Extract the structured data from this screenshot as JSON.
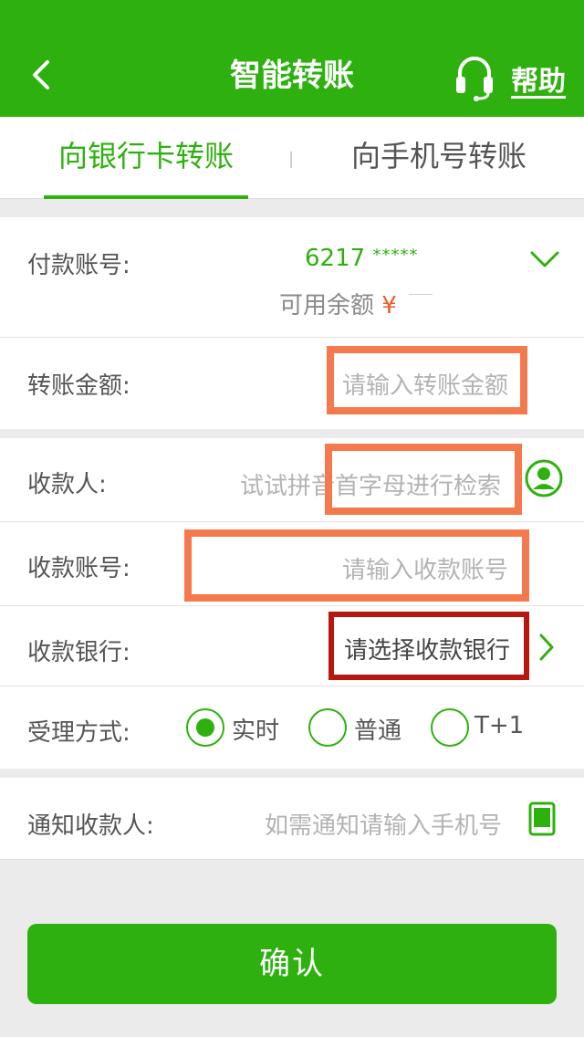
{
  "header": {
    "title": "智能转账",
    "back_icon": "chevron-left-icon",
    "help_icon": "headset-icon",
    "help_label": "帮助"
  },
  "tabs": [
    {
      "label": "向银行卡转账",
      "active": true
    },
    {
      "label": "向手机号转账",
      "active": false
    }
  ],
  "payment": {
    "account_label": "付款账号:",
    "account_number": "6217",
    "account_mask": "*****",
    "balance_label": "可用余额",
    "balance_currency": "¥",
    "amount_label": "转账金额:",
    "amount_placeholder": "请输入转账金额"
  },
  "payee": {
    "name_label": "收款人:",
    "name_placeholder": "试试拼音首字母进行检索",
    "contact_icon": "contact-person-icon",
    "account_label": "收款账号:",
    "account_placeholder": "请输入收款账号",
    "bank_label": "收款银行:",
    "bank_placeholder": "请选择收款银行",
    "method_label": "受理方式:",
    "methods": [
      {
        "label": "实时",
        "selected": true
      },
      {
        "label": "普通",
        "selected": false
      },
      {
        "label": "T+1",
        "selected": false
      }
    ]
  },
  "notify": {
    "label": "通知收款人:",
    "placeholder": "如需通知请输入手机号",
    "phone_icon": "mobile-phone-icon"
  },
  "confirm_label": "确认",
  "colors": {
    "brand_green": "#2eb10f",
    "highlight_orange": "#f47a4e",
    "highlight_dark_red": "#b8170f",
    "currency_orange": "#f05a23"
  }
}
